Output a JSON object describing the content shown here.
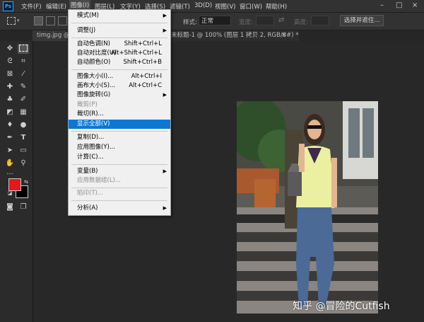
{
  "menubar": {
    "logo": "Ps",
    "items": [
      {
        "label": "文件(F)"
      },
      {
        "label": "编辑(E)"
      },
      {
        "label": "图像(I)"
      },
      {
        "label": "图层(L)"
      },
      {
        "label": "文字(Y)"
      },
      {
        "label": "选择(S)"
      },
      {
        "label": "滤镜(T)"
      },
      {
        "label": "3D(D)"
      },
      {
        "label": "视图(V)"
      },
      {
        "label": "窗口(W)"
      },
      {
        "label": "帮助(H)"
      }
    ],
    "window_controls": [
      "–",
      "□",
      "×"
    ]
  },
  "options": {
    "style_label": "样式:",
    "style_value": "正常",
    "width_label": "宽度:",
    "height_label": "高度:",
    "select_mask_button": "选择并遮住..."
  },
  "tabs": [
    {
      "label": "timg.jpg @"
    },
    {
      "label": "未标题-1 @ 100% (图层 1 拷贝 2, RGB/8#) *"
    },
    {
      "label": "×"
    }
  ],
  "image_menu": {
    "items": [
      {
        "label": "模式(M)",
        "shortcut": "",
        "submenu": true,
        "disabled": false
      },
      {
        "label": "调整(J)",
        "shortcut": "",
        "submenu": true,
        "disabled": false
      },
      {
        "label": "自动色调(N)",
        "shortcut": "Shift+Ctrl+L",
        "submenu": false,
        "disabled": false
      },
      {
        "label": "自动对比度(U)",
        "shortcut": "Alt+Shift+Ctrl+L",
        "submenu": false,
        "disabled": false
      },
      {
        "label": "自动颜色(O)",
        "shortcut": "Shift+Ctrl+B",
        "submenu": false,
        "disabled": false
      },
      {
        "label": "图像大小(I)...",
        "shortcut": "Alt+Ctrl+I",
        "submenu": false,
        "disabled": false
      },
      {
        "label": "画布大小(S)...",
        "shortcut": "Alt+Ctrl+C",
        "submenu": false,
        "disabled": false
      },
      {
        "label": "图像旋转(G)",
        "shortcut": "",
        "submenu": true,
        "disabled": false
      },
      {
        "label": "裁剪(P)",
        "shortcut": "",
        "submenu": false,
        "disabled": true
      },
      {
        "label": "裁切(R)...",
        "shortcut": "",
        "submenu": false,
        "disabled": false
      },
      {
        "label": "显示全部(V)",
        "shortcut": "",
        "submenu": false,
        "disabled": false,
        "highlighted": true
      },
      {
        "label": "复制(D)...",
        "shortcut": "",
        "submenu": false,
        "disabled": false
      },
      {
        "label": "应用图像(Y)...",
        "shortcut": "",
        "submenu": false,
        "disabled": false
      },
      {
        "label": "计算(C)...",
        "shortcut": "",
        "submenu": false,
        "disabled": false
      },
      {
        "label": "变量(B)",
        "shortcut": "",
        "submenu": true,
        "disabled": false
      },
      {
        "label": "应用数据组(L)...",
        "shortcut": "",
        "submenu": false,
        "disabled": true
      },
      {
        "label": "陷印(T)...",
        "shortcut": "",
        "submenu": false,
        "disabled": true
      },
      {
        "label": "分析(A)",
        "shortcut": "",
        "submenu": true,
        "disabled": false
      }
    ]
  },
  "colors": {
    "foreground": "#e0191c",
    "background": "#000000",
    "highlight": "#0c78d4"
  },
  "watermark": "知乎 @冒险的Cutfish"
}
